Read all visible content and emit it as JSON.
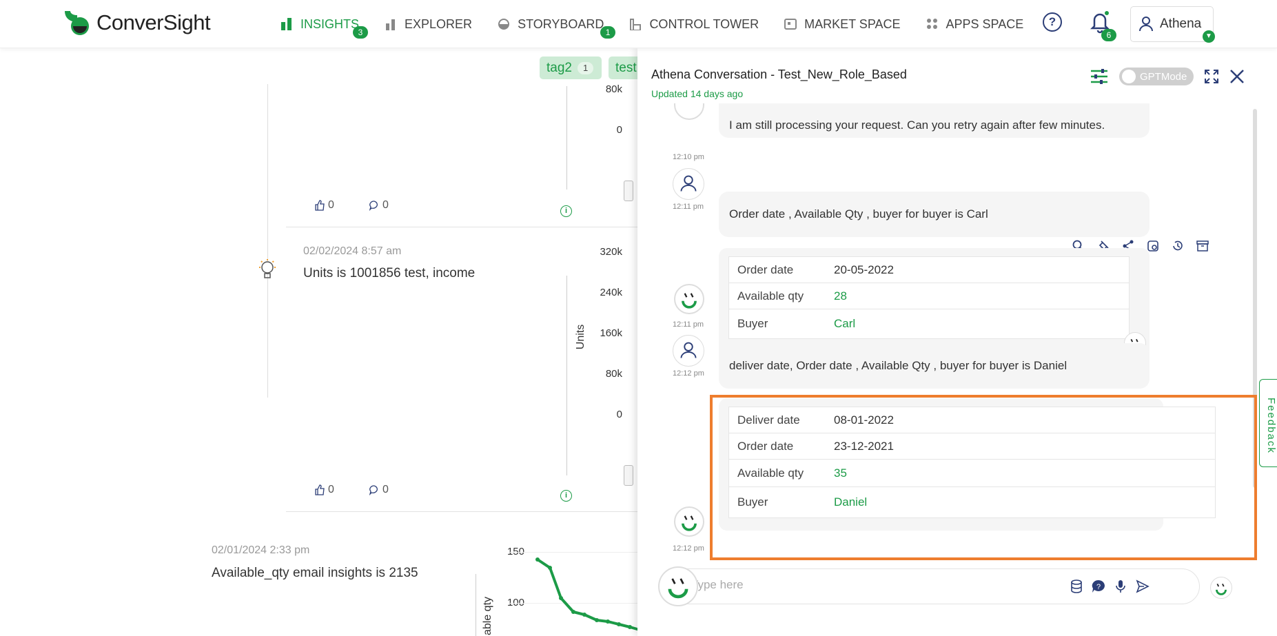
{
  "brand": {
    "name": "ConverSight",
    "accent": "#1c9b47",
    "highlight": "#ee7d2e"
  },
  "nav": {
    "items": [
      {
        "label": "INSIGHTS",
        "icon": "bar-chart-icon",
        "badge": "3",
        "active": true
      },
      {
        "label": "EXPLORER",
        "icon": "explorer-icon",
        "badge": "",
        "active": false
      },
      {
        "label": "STORYBOARD",
        "icon": "storyboard-icon",
        "badge": "1",
        "active": false
      },
      {
        "label": "CONTROL TOWER",
        "icon": "control-tower-icon",
        "badge": "",
        "active": false
      },
      {
        "label": "MARKET SPACE",
        "icon": "market-space-icon",
        "badge": "",
        "active": false
      },
      {
        "label": "APPS SPACE",
        "icon": "apps-space-icon",
        "badge": "",
        "active": false
      }
    ]
  },
  "header": {
    "help": "?",
    "notifications": "6",
    "user": "Athena"
  },
  "dashboard": {
    "tags": [
      {
        "label": "tag2",
        "count": "1"
      },
      {
        "label": "test",
        "count": ""
      }
    ],
    "card1": {
      "axis": [
        "80k",
        "0"
      ],
      "likes": "0",
      "comments": "0"
    },
    "card2": {
      "date": "02/02/2024 8:57 am",
      "text": "Units is 1001856 test, income",
      "axis": [
        "320k",
        "240k",
        "160k",
        "80k",
        "0"
      ],
      "ylabel": "Units",
      "likes": "0",
      "comments": "0"
    },
    "card3": {
      "date": "02/01/2024 2:33 pm",
      "text": "Available_qty email insights is 2135",
      "axis": [
        "150",
        "100"
      ],
      "ylabel": "able qty"
    }
  },
  "panel": {
    "title": "Athena Conversation - Test_New_Role_Based",
    "updated": "Updated 14 days ago",
    "gpt_mode": "GPTMode",
    "messages": {
      "m0": {
        "text": "I am still processing your request. Can you retry again after few minutes.",
        "time": "12:10 pm"
      },
      "m1": {
        "text": "Order date , Available Qty , buyer for buyer is Carl",
        "time": "12:11 pm"
      },
      "m2": {
        "time": "12:11 pm",
        "rows": [
          {
            "k": "Order date",
            "v": "20-05-2022"
          },
          {
            "k": "Available qty",
            "v": "28"
          },
          {
            "k": "Buyer",
            "v": "Carl"
          }
        ]
      },
      "m3": {
        "text": "deliver date, Order date , Available Qty , buyer for buyer is Daniel",
        "time": "12:12 pm"
      },
      "m4": {
        "time": "12:12 pm",
        "rows": [
          {
            "k": "Deliver date",
            "v": "08-01-2022"
          },
          {
            "k": "Order date",
            "v": "23-12-2021"
          },
          {
            "k": "Available qty",
            "v": "35"
          },
          {
            "k": "Buyer",
            "v": "Daniel"
          }
        ]
      }
    },
    "input_placeholder": "Type here",
    "feedback": "Feedback"
  }
}
